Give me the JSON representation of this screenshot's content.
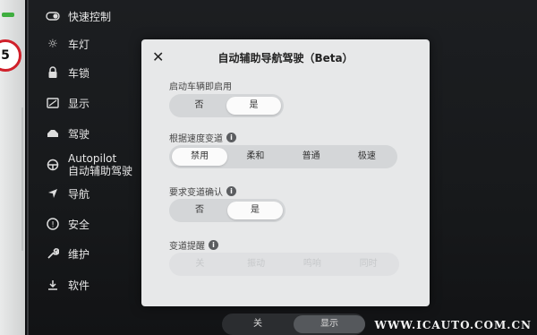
{
  "sidebar": {
    "items": [
      {
        "icon": "toggle-icon",
        "label": "快速控制"
      },
      {
        "icon": "light-icon",
        "label": "车灯"
      },
      {
        "icon": "lock-icon",
        "label": "车锁"
      },
      {
        "icon": "display-icon",
        "label": "显示"
      },
      {
        "icon": "steering-wheel-icon",
        "label": "驾驶"
      },
      {
        "icon": "autopilot-wheel-icon",
        "label": "Autopilot",
        "sublabel": "自动辅助驾驶"
      },
      {
        "icon": "navigation-arrow-icon",
        "label": "导航"
      },
      {
        "icon": "safety-icon",
        "label": "安全"
      },
      {
        "icon": "wrench-icon",
        "label": "维护"
      },
      {
        "icon": "download-icon",
        "label": "软件"
      }
    ]
  },
  "speed_limit": "5",
  "modal": {
    "title": "自动辅助导航驾驶（Beta）",
    "sections": [
      {
        "label": "启动车辆即启用",
        "options": [
          "否",
          "是"
        ],
        "selected": "是",
        "info": false
      },
      {
        "label": "根据速度变道",
        "options": [
          "禁用",
          "柔和",
          "普通",
          "极速"
        ],
        "selected": "禁用",
        "info": true
      },
      {
        "label": "要求变道确认",
        "options": [
          "否",
          "是"
        ],
        "selected": "是",
        "info": true
      },
      {
        "label": "变道提醒",
        "options": [
          "关",
          "振动",
          "鸣响",
          "同时"
        ],
        "selected": "",
        "info": true,
        "disabled": true
      }
    ]
  },
  "bottom_bar": {
    "options": [
      "关",
      "显示"
    ],
    "selected": "显示"
  },
  "watermark": "WWW.ICAUTO.COM.CN"
}
